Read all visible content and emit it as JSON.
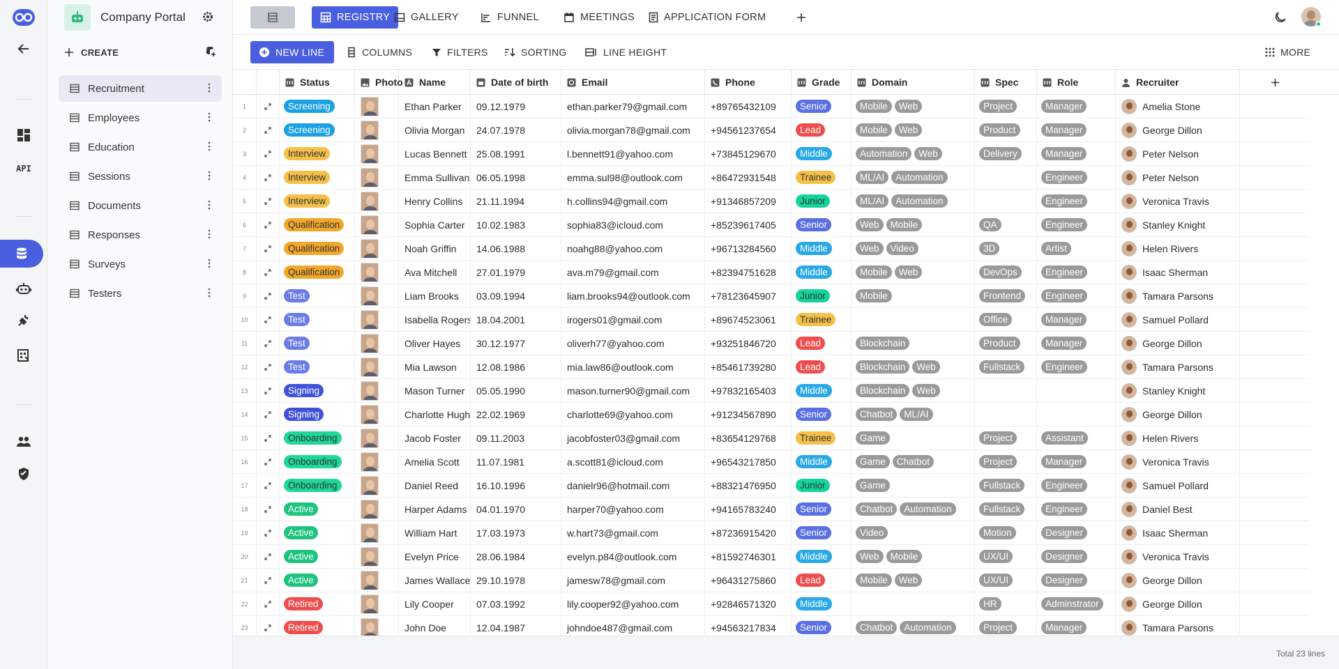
{
  "app": {
    "name": "Company Portal"
  },
  "colors": {
    "accent": "#4a5fe0",
    "rail_bg": "#f4f5f7"
  },
  "rail": {
    "items": [
      "logo-icon",
      "back-arrow-icon",
      "dashboard-icon",
      "api-icon",
      "database-icon",
      "bot-icon",
      "plug-icon",
      "reports-icon",
      "users-icon",
      "shield-icon"
    ],
    "api_label": "API"
  },
  "sidebar": {
    "create_label": "CREATE",
    "tables": [
      "Recruitment",
      "Employees",
      "Education",
      "Sessions",
      "Documents",
      "Responses",
      "Surveys",
      "Testers"
    ]
  },
  "topbar": {
    "tabs": [
      {
        "label": "REGISTRY",
        "icon": "table-icon"
      },
      {
        "label": "GALLERY",
        "icon": "gallery-icon"
      },
      {
        "label": "FUNNEL",
        "icon": "funnel-icon"
      },
      {
        "label": "MEETINGS",
        "icon": "calendar-icon"
      },
      {
        "label": "APPLICATION FORM",
        "icon": "form-icon"
      }
    ]
  },
  "actionbar": {
    "new_line": "NEW LINE",
    "columns": "COLUMNS",
    "filters": "FILTERS",
    "sorting": "SORTING",
    "line_height": "LINE HEIGHT",
    "more": "MORE"
  },
  "grid": {
    "columns": [
      "Status",
      "Photo",
      "Name",
      "Date of birth",
      "Email",
      "Phone",
      "Grade",
      "Domain",
      "Spec",
      "Role",
      "Recruiter"
    ],
    "status_colors": {
      "Screening": {
        "bg": "#1ba1e2",
        "fg": "#ffffff"
      },
      "Interview": {
        "bg": "#f5c04a",
        "fg": "#333333"
      },
      "Qualification": {
        "bg": "#f0a72b",
        "fg": "#333333"
      },
      "Test": {
        "bg": "#6b7ce6",
        "fg": "#ffffff"
      },
      "Signing": {
        "bg": "#4152d8",
        "fg": "#ffffff"
      },
      "Onboarding": {
        "bg": "#1fd79a",
        "fg": "#333333"
      },
      "Active": {
        "bg": "#1ec47e",
        "fg": "#ffffff"
      },
      "Retired": {
        "bg": "#ef4d4d",
        "fg": "#ffffff"
      }
    },
    "grade_colors": {
      "Senior": {
        "bg": "#5b6fe5",
        "fg": "#ffffff"
      },
      "Lead": {
        "bg": "#ef4d4d",
        "fg": "#ffffff"
      },
      "Middle": {
        "bg": "#29a8e6",
        "fg": "#ffffff"
      },
      "Trainee": {
        "bg": "#f5c04a",
        "fg": "#333333"
      },
      "Junior": {
        "bg": "#12d49c",
        "fg": "#333333"
      }
    },
    "rows": [
      {
        "n": "1",
        "status": "Screening",
        "name": "Ethan Parker",
        "dob": "09.12.1979",
        "email": "ethan.parker79@gmail.com",
        "phone": "+89765432109",
        "grade": "Senior",
        "domain": [
          "Mobile",
          "Web"
        ],
        "spec": "Project",
        "role": "Manager",
        "recruiter": "Amelia Stone"
      },
      {
        "n": "2",
        "status": "Screening",
        "name": "Olivia Morgan",
        "dob": "24.07.1978",
        "email": "olivia.morgan78@gmail.com",
        "phone": "+94561237654",
        "grade": "Lead",
        "domain": [
          "Mobile",
          "Web"
        ],
        "spec": "Product",
        "role": "Manager",
        "recruiter": "George Dillon"
      },
      {
        "n": "3",
        "status": "Interview",
        "name": "Lucas Bennett",
        "dob": "25.08.1991",
        "email": "l.bennett91@yahoo.com",
        "phone": "+73845129670",
        "grade": "Middle",
        "domain": [
          "Automation",
          "Web"
        ],
        "spec": "Delivery",
        "role": "Manager",
        "recruiter": "Peter Nelson"
      },
      {
        "n": "4",
        "status": "Interview",
        "name": "Emma Sullivan",
        "dob": "06.05.1998",
        "email": "emma.sul98@outlook.com",
        "phone": "+86472931548",
        "grade": "Trainee",
        "domain": [
          "ML/AI",
          "Automation"
        ],
        "spec": "",
        "role": "Engineer",
        "recruiter": "Peter Nelson"
      },
      {
        "n": "5",
        "status": "Interview",
        "name": "Henry Collins",
        "dob": "21.11.1994",
        "email": "h.collins94@gmail.com",
        "phone": "+91346857209",
        "grade": "Junior",
        "domain": [
          "ML/AI",
          "Automation"
        ],
        "spec": "",
        "role": "Engineer",
        "recruiter": "Veronica Travis"
      },
      {
        "n": "6",
        "status": "Qualification",
        "name": "Sophia Carter",
        "dob": "10.02.1983",
        "email": "sophia83@icloud.com",
        "phone": "+85239617405",
        "grade": "Senior",
        "domain": [
          "Web",
          "Mobile"
        ],
        "spec": "QA",
        "role": "Engineer",
        "recruiter": "Stanley Knight"
      },
      {
        "n": "7",
        "status": "Qualification",
        "name": "Noah Griffin",
        "dob": "14.06.1988",
        "email": "noahg88@yahoo.com",
        "phone": "+96713284560",
        "grade": "Middle",
        "domain": [
          "Web",
          "Video"
        ],
        "spec": "3D",
        "role": "Artist",
        "recruiter": "Helen Rivers"
      },
      {
        "n": "8",
        "status": "Qualification",
        "name": "Ava Mitchell",
        "dob": "27.01.1979",
        "email": "ava.m79@gmail.com",
        "phone": "+82394751628",
        "grade": "Middle",
        "domain": [
          "Mobile",
          "Web"
        ],
        "spec": "DevOps",
        "role": "Engineer",
        "recruiter": "Isaac Sherman"
      },
      {
        "n": "9",
        "status": "Test",
        "name": "Liam Brooks",
        "dob": "03.09.1994",
        "email": "liam.brooks94@outlook.com",
        "phone": "+78123645907",
        "grade": "Junior",
        "domain": [
          "Mobile"
        ],
        "spec": "Frontend",
        "role": "Engineer",
        "recruiter": "Tamara Parsons"
      },
      {
        "n": "10",
        "status": "Test",
        "name": "Isabella Rogers",
        "dob": "18.04.2001",
        "email": "irogers01@gmail.com",
        "phone": "+89674523061",
        "grade": "Trainee",
        "domain": [],
        "spec": "Office",
        "role": "Manager",
        "recruiter": "Samuel Pollard"
      },
      {
        "n": "11",
        "status": "Test",
        "name": "Oliver Hayes",
        "dob": "30.12.1977",
        "email": "oliverh77@yahoo.com",
        "phone": "+93251846720",
        "grade": "Lead",
        "domain": [
          "Blockchain"
        ],
        "spec": "Product",
        "role": "Manager",
        "recruiter": "George Dillon"
      },
      {
        "n": "12",
        "status": "Test",
        "name": "Mia Lawson",
        "dob": "12.08.1986",
        "email": "mia.law86@outlook.com",
        "phone": "+85461739280",
        "grade": "Lead",
        "domain": [
          "Blockchain",
          "Web"
        ],
        "spec": "Fullstack",
        "role": "Engineer",
        "recruiter": "Tamara Parsons"
      },
      {
        "n": "13",
        "status": "Signing",
        "name": "Mason Turner",
        "dob": "05.05.1990",
        "email": "mason.turner90@gmail.com",
        "phone": "+97832165403",
        "grade": "Middle",
        "domain": [
          "Blockchain",
          "Web"
        ],
        "spec": "",
        "role": "",
        "recruiter": "Stanley Knight"
      },
      {
        "n": "14",
        "status": "Signing",
        "name": "Charlotte Hughes",
        "dob": "22.02.1969",
        "email": "charlotte69@yahoo.com",
        "phone": "+91234567890",
        "grade": "Senior",
        "domain": [
          "Chatbot",
          "ML/AI"
        ],
        "spec": "",
        "role": "",
        "recruiter": "George Dillon"
      },
      {
        "n": "15",
        "status": "Onboarding",
        "name": "Jacob Foster",
        "dob": "09.11.2003",
        "email": "jacobfoster03@gmail.com",
        "phone": "+83654129768",
        "grade": "Trainee",
        "domain": [
          "Game"
        ],
        "spec": "Project",
        "role": "Assistant",
        "recruiter": "Helen Rivers"
      },
      {
        "n": "16",
        "status": "Onboarding",
        "name": "Amelia Scott",
        "dob": "11.07.1981",
        "email": "a.scott81@icloud.com",
        "phone": "+96543217850",
        "grade": "Middle",
        "domain": [
          "Game",
          "Chatbot"
        ],
        "spec": "Project",
        "role": "Manager",
        "recruiter": "Veronica Travis"
      },
      {
        "n": "17",
        "status": "Onboarding",
        "name": "Daniel Reed",
        "dob": "16.10.1996",
        "email": "danielr96@hotmail.com",
        "phone": "+88321476950",
        "grade": "Junior",
        "domain": [
          "Game"
        ],
        "spec": "Fullstack",
        "role": "Engineer",
        "recruiter": "Samuel Pollard"
      },
      {
        "n": "18",
        "status": "Active",
        "name": "Harper Adams",
        "dob": "04.01.1970",
        "email": "harper70@yahoo.com",
        "phone": "+94165783240",
        "grade": "Senior",
        "domain": [
          "Chatbot",
          "Automation"
        ],
        "spec": "Fullstack",
        "role": "Engineer",
        "recruiter": "Daniel Best"
      },
      {
        "n": "19",
        "status": "Active",
        "name": "William Hart",
        "dob": "17.03.1973",
        "email": "w.hart73@gmail.com",
        "phone": "+87236915420",
        "grade": "Senior",
        "domain": [
          "Video"
        ],
        "spec": "Motion",
        "role": "Designer",
        "recruiter": "Isaac Sherman"
      },
      {
        "n": "20",
        "status": "Active",
        "name": "Evelyn Price",
        "dob": "28.06.1984",
        "email": "evelyn.p84@outlook.com",
        "phone": "+81592746301",
        "grade": "Middle",
        "domain": [
          "Web",
          "Mobile"
        ],
        "spec": "UX/UI",
        "role": "Designer",
        "recruiter": "Veronica Travis"
      },
      {
        "n": "21",
        "status": "Active",
        "name": "James Wallace",
        "dob": "29.10.1978",
        "email": "jamesw78@gmail.com",
        "phone": "+96431275860",
        "grade": "Lead",
        "domain": [
          "Mobile",
          "Web"
        ],
        "spec": "UX/UI",
        "role": "Designer",
        "recruiter": "George Dillon"
      },
      {
        "n": "22",
        "status": "Retired",
        "name": "Lily Cooper",
        "dob": "07.03.1992",
        "email": "lily.cooper92@yahoo.com",
        "phone": "+92846571320",
        "grade": "Middle",
        "domain": [],
        "spec": "HR",
        "role": "Adminstrator",
        "recruiter": "George Dillon"
      },
      {
        "n": "23",
        "status": "Retired",
        "name": "John Doe",
        "dob": "12.04.1987",
        "email": "johndoe487@gmail.com",
        "phone": "+94563217834",
        "grade": "Senior",
        "domain": [
          "Chatbot",
          "Automation"
        ],
        "spec": "Project",
        "role": "Manager",
        "recruiter": "Tamara Parsons"
      }
    ]
  },
  "footer": {
    "total": "Total 23 lines"
  }
}
